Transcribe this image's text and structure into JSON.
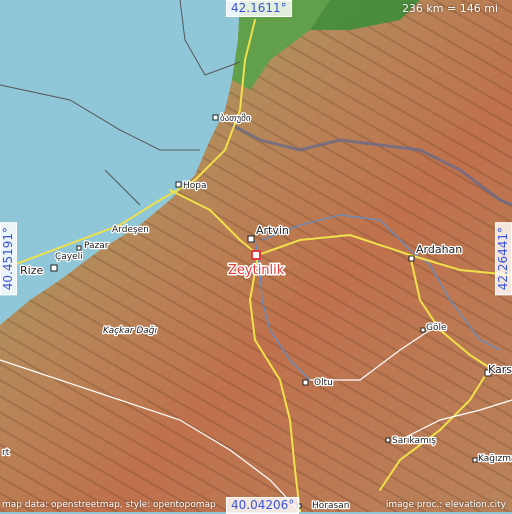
{
  "map": {
    "coords": {
      "top": "42.1611°",
      "bottom": "40.04206°",
      "left": "40.45191°",
      "right": "42.26441°"
    },
    "scale_text": "236 km = 146 mi",
    "attribution_left": "map data: openstreetmap, style: opentopomap",
    "attribution_right": "image proc.: elevation.city",
    "main_place": "Zeytinlik",
    "places": {
      "artvin": "Artvin",
      "ardahan": "Ardahan",
      "hopa": "Hopa",
      "rize": "Rize",
      "ardesen": "Ardeşen",
      "pazar": "Pazar",
      "cayeli": "Çayeli",
      "kackar": "Kaçkar Dağı",
      "gole": "Göle",
      "oltu": "Oltu",
      "kars": "Kars",
      "sarikamis": "Sarıkamış",
      "horasan": "Horasan",
      "kagizman": "Kağızman",
      "batumi": "ბათუმი",
      "art_edge": "rt"
    }
  }
}
